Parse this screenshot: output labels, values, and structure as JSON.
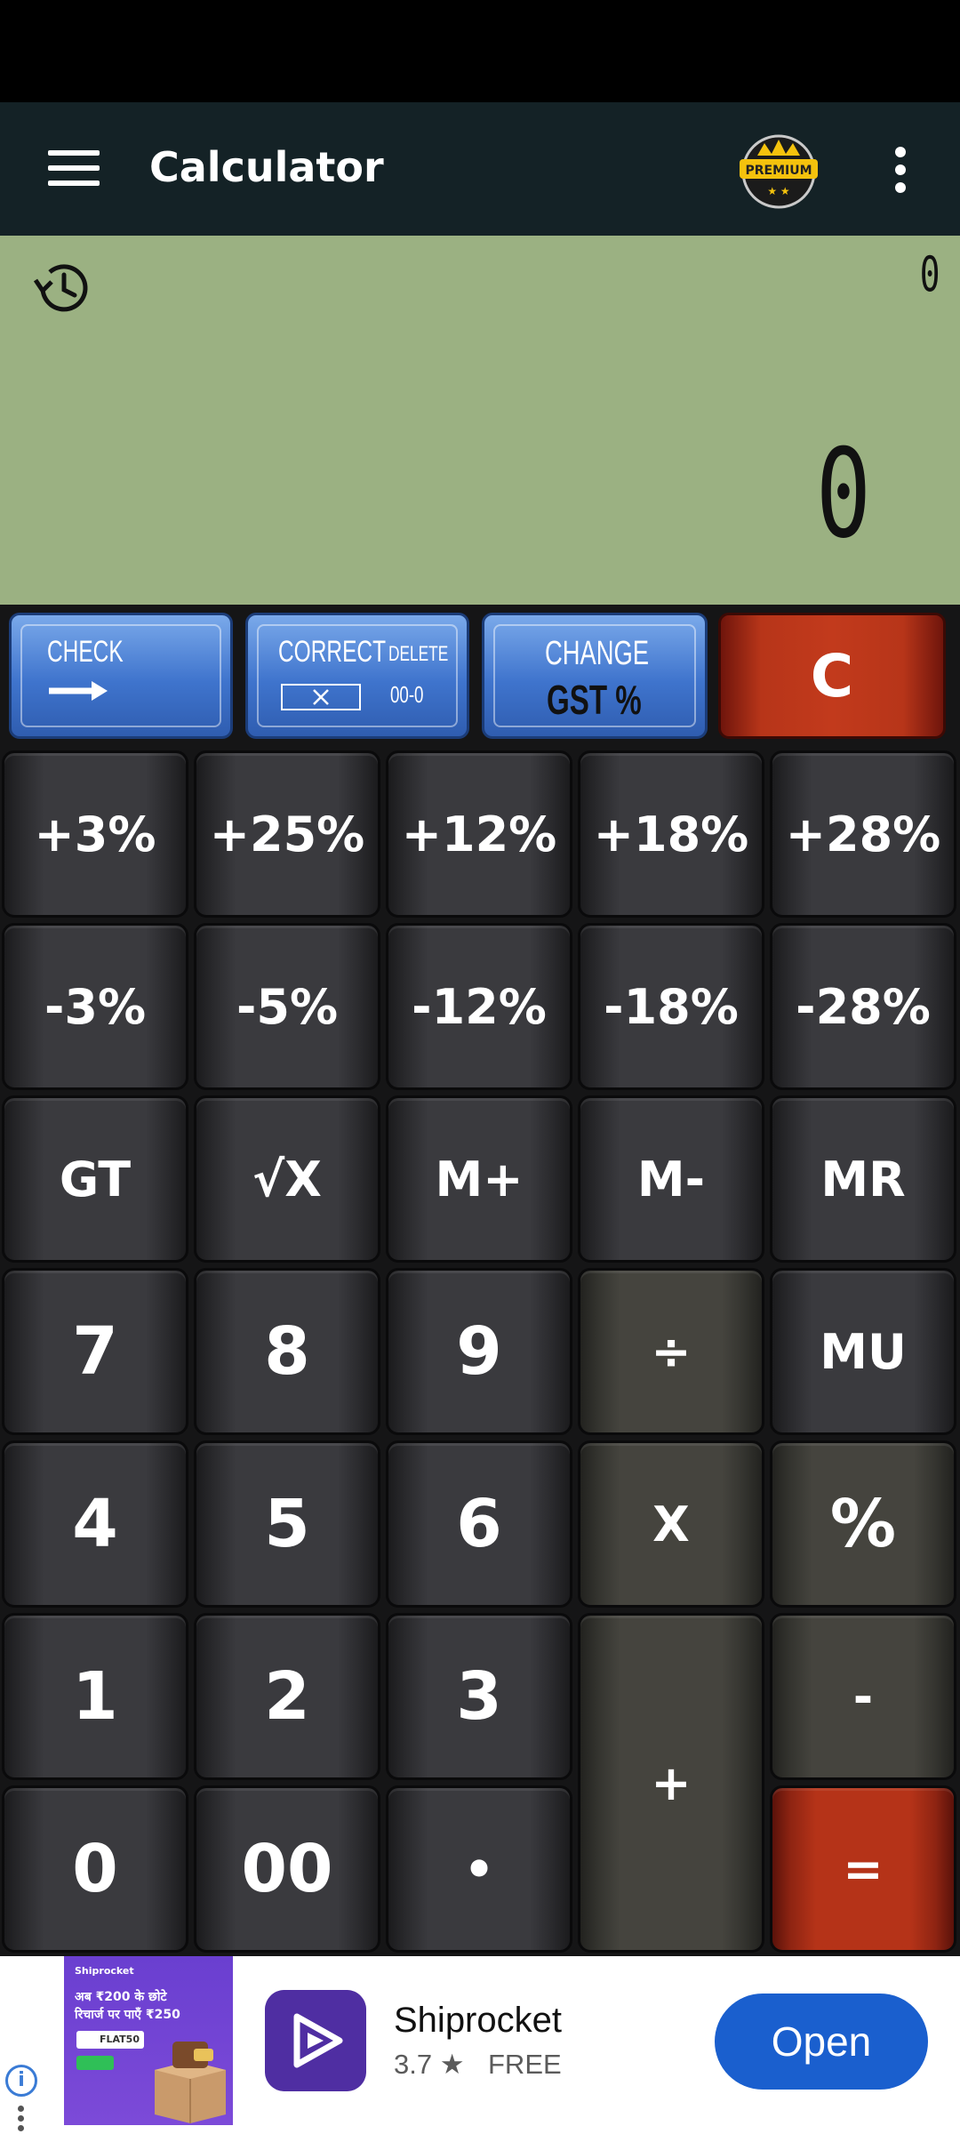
{
  "app": {
    "title": "Calculator",
    "premium_label": "PREMIUM"
  },
  "display": {
    "memory_value": "0",
    "main_value": "0"
  },
  "top_buttons": {
    "check": {
      "label": "CHECK"
    },
    "correct": {
      "label": "CORRECT",
      "delete_label": "DELETE",
      "delete_hint": "00-0"
    },
    "change": {
      "label_top": "CHANGE",
      "label_bottom": "GST %"
    },
    "clear": {
      "label": "C"
    }
  },
  "keys": {
    "plus3": "+3%",
    "plus25": "+25%",
    "plus12": "+12%",
    "plus18": "+18%",
    "plus28": "+28%",
    "minus3": "-3%",
    "minus5": "-5%",
    "minus12": "-12%",
    "minus18": "-18%",
    "minus28": "-28%",
    "gt": "GT",
    "sqrt": "√X",
    "mplus": "M+",
    "mminus": "M-",
    "mr": "MR",
    "seven": "7",
    "eight": "8",
    "nine": "9",
    "divide": "÷",
    "mu": "MU",
    "four": "4",
    "five": "5",
    "six": "6",
    "multiply": "X",
    "percent": "%",
    "one": "1",
    "two": "2",
    "three": "3",
    "minus": "-",
    "zero": "0",
    "double_zero": "00",
    "dot": "•",
    "plus": "+",
    "equals": "="
  },
  "ad": {
    "banner_brand": "Shiprocket",
    "banner_line1": "अब ₹200 के छोटे",
    "banner_line2": "रिचार्ज पर पाएँ ₹250",
    "banner_code": "FLAT50",
    "app_name": "Shiprocket",
    "rating": "3.7 ★",
    "price": "FREE",
    "cta": "Open",
    "info_icon": "i"
  },
  "colors": {
    "appbar": "#142226",
    "display_bg": "#9bb182",
    "blue_button": "#3f74cd",
    "red_button": "#b53318",
    "ad_cta": "#1a5fce"
  }
}
